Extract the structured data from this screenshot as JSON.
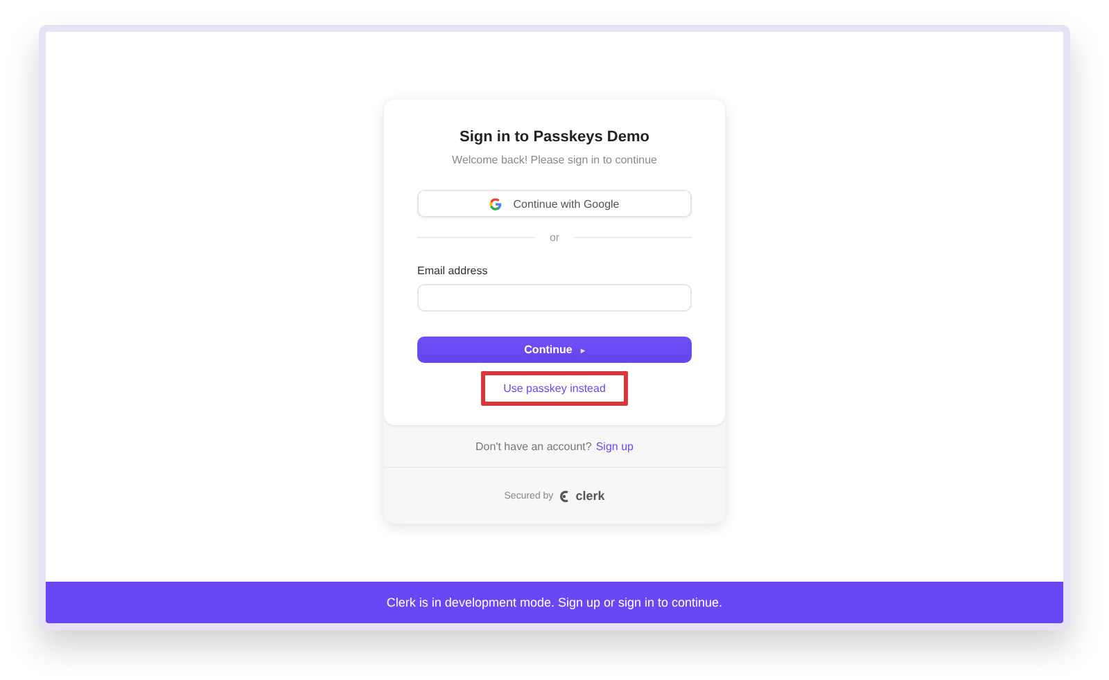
{
  "card": {
    "title": "Sign in to Passkeys Demo",
    "subtitle": "Welcome back! Please sign in to continue",
    "social_button": {
      "label": "Continue with Google"
    },
    "divider": "or",
    "email": {
      "label": "Email address"
    },
    "continue_button": {
      "label": "Continue",
      "arrow": "▸"
    },
    "passkey_link": {
      "label": "Use passkey instead",
      "highlighted": true
    },
    "footer": {
      "prompt": "Don't have an account?",
      "link": "Sign up",
      "secured_by": "Secured by",
      "brand": "clerk"
    }
  },
  "banner": "Clerk is in development mode. Sign up or sign in to continue."
}
